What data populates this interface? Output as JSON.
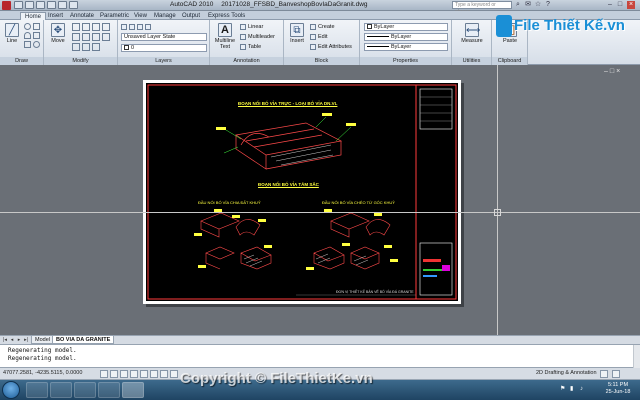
{
  "window": {
    "app_title": "AutoCAD 2010",
    "file_title": "20171028_FFSBD_BanveshopBovIaDaGranit.dwg",
    "search_placeholder": "Type a keyword or phrase"
  },
  "ribbon_tabs": [
    "Home",
    "Insert",
    "Annotate",
    "Parametric",
    "View",
    "Manage",
    "Output",
    "Express Tools"
  ],
  "ribbon": {
    "draw": {
      "label": "Draw",
      "line_label": "Line"
    },
    "modify": {
      "label": "Modify",
      "move_label": "Move"
    },
    "layers": {
      "label": "Layers",
      "state": "Unsaved Layer State",
      "layer": "0"
    },
    "annotation": {
      "label": "Annotation",
      "mtext_label": "Multiline Text",
      "linear": "Linear",
      "multileader": "Multileader",
      "table": "Table"
    },
    "block": {
      "label": "Block",
      "insert_label": "Insert",
      "create": "Create",
      "edit": "Edit",
      "edit_attributes": "Edit Attributes"
    },
    "properties": {
      "label": "Properties",
      "color": "ByLayer",
      "linetype": "ByLayer",
      "lineweight": "ByLayer"
    },
    "utilities": {
      "label": "Utilities",
      "measure_label": "Measure"
    },
    "clipboard": {
      "label": "Clipboard",
      "paste_label": "Paste"
    }
  },
  "logo": {
    "text": "File Thiết Kế.vn"
  },
  "drawing": {
    "title_top": "ĐOẠN NỐI BÓ VỈA TRỰC - LOẠI BÓ VỈA DN.VL",
    "title_mid": "ĐOẠN NỐI BÓ VỈA TĂM SẮC",
    "label_left": "ĐẦU NỐI BÓ VỈA CHIA ĐẤT KHUỶ",
    "label_right": "ĐẦU NỐI BÓ VỈA CHÉO TỪ GÓC KHUỶ",
    "footer_note": "ĐƠN VỊ THIẾT KẾ BẢN VẼ BỐ VỈA ĐÁ GRANITE"
  },
  "layout_tabs": [
    "Model",
    "BO VIA DA GRANITE"
  ],
  "active_layout_tab": "BO VIA DA GRANITE",
  "command_history": [
    "Regenerating model.",
    "Regenerating model."
  ],
  "status": {
    "coords": "47077.2581, -4235.5115, 0.0000",
    "workspace": "2D Drafting & Annotation"
  },
  "taskbar": {
    "time": "5:11 PM",
    "date": "25-Jun-18"
  },
  "watermark": "Copyright © FileThietKe.vn"
}
